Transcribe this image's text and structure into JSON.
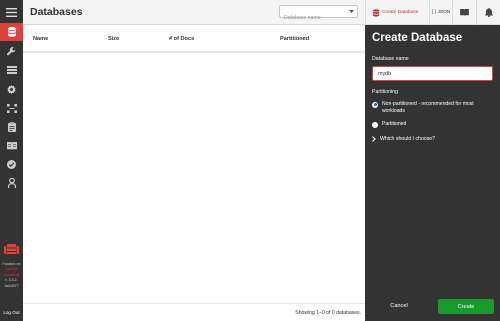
{
  "header": {
    "title": "Databases",
    "search_placeholder": "Database name",
    "search_value": ""
  },
  "toolbar": {
    "create_database_label": "Create Database",
    "json_label": "{ } JSON"
  },
  "table": {
    "columns": [
      "Name",
      "Size",
      "# of Docs",
      "Partitioned"
    ],
    "rows": []
  },
  "footer": {
    "showing_text": "Showing 1–0 of 0 databases."
  },
  "sidebar": {
    "items": [
      {
        "icon": "menu-icon",
        "active": false
      },
      {
        "icon": "database-icon",
        "active": true
      },
      {
        "icon": "wrench-icon",
        "active": false
      },
      {
        "icon": "active-tasks-icon",
        "active": false
      },
      {
        "icon": "gear-icon",
        "active": false
      },
      {
        "icon": "replication-icon",
        "active": false
      },
      {
        "icon": "clipboard-icon",
        "active": false
      },
      {
        "icon": "documentation-book-icon",
        "active": false
      },
      {
        "icon": "verify-check-icon",
        "active": false
      },
      {
        "icon": "user-icon",
        "active": false
      }
    ],
    "fauxton_on": "Fauxton on",
    "apache_couchdb": "Apache CouchDB",
    "version": "v. 3.4.2-9a0d977",
    "logout_label": "Log Out"
  },
  "create_panel": {
    "title": "Create Database",
    "name_label": "Database name",
    "name_value": "mydb",
    "partitioning_label": "Partitioning",
    "options": [
      {
        "label": "Non-partitioned - recommended for most workloads",
        "checked": true
      },
      {
        "label": "Partitioned",
        "checked": false
      }
    ],
    "help_label": "Which should I choose?",
    "cancel_label": "Cancel",
    "create_label": "Create"
  },
  "colors": {
    "sidebar_bg": "#333333",
    "accent_red": "#e33f3b",
    "create_green": "#179b2c",
    "header_bg": "#f4f4f4"
  }
}
